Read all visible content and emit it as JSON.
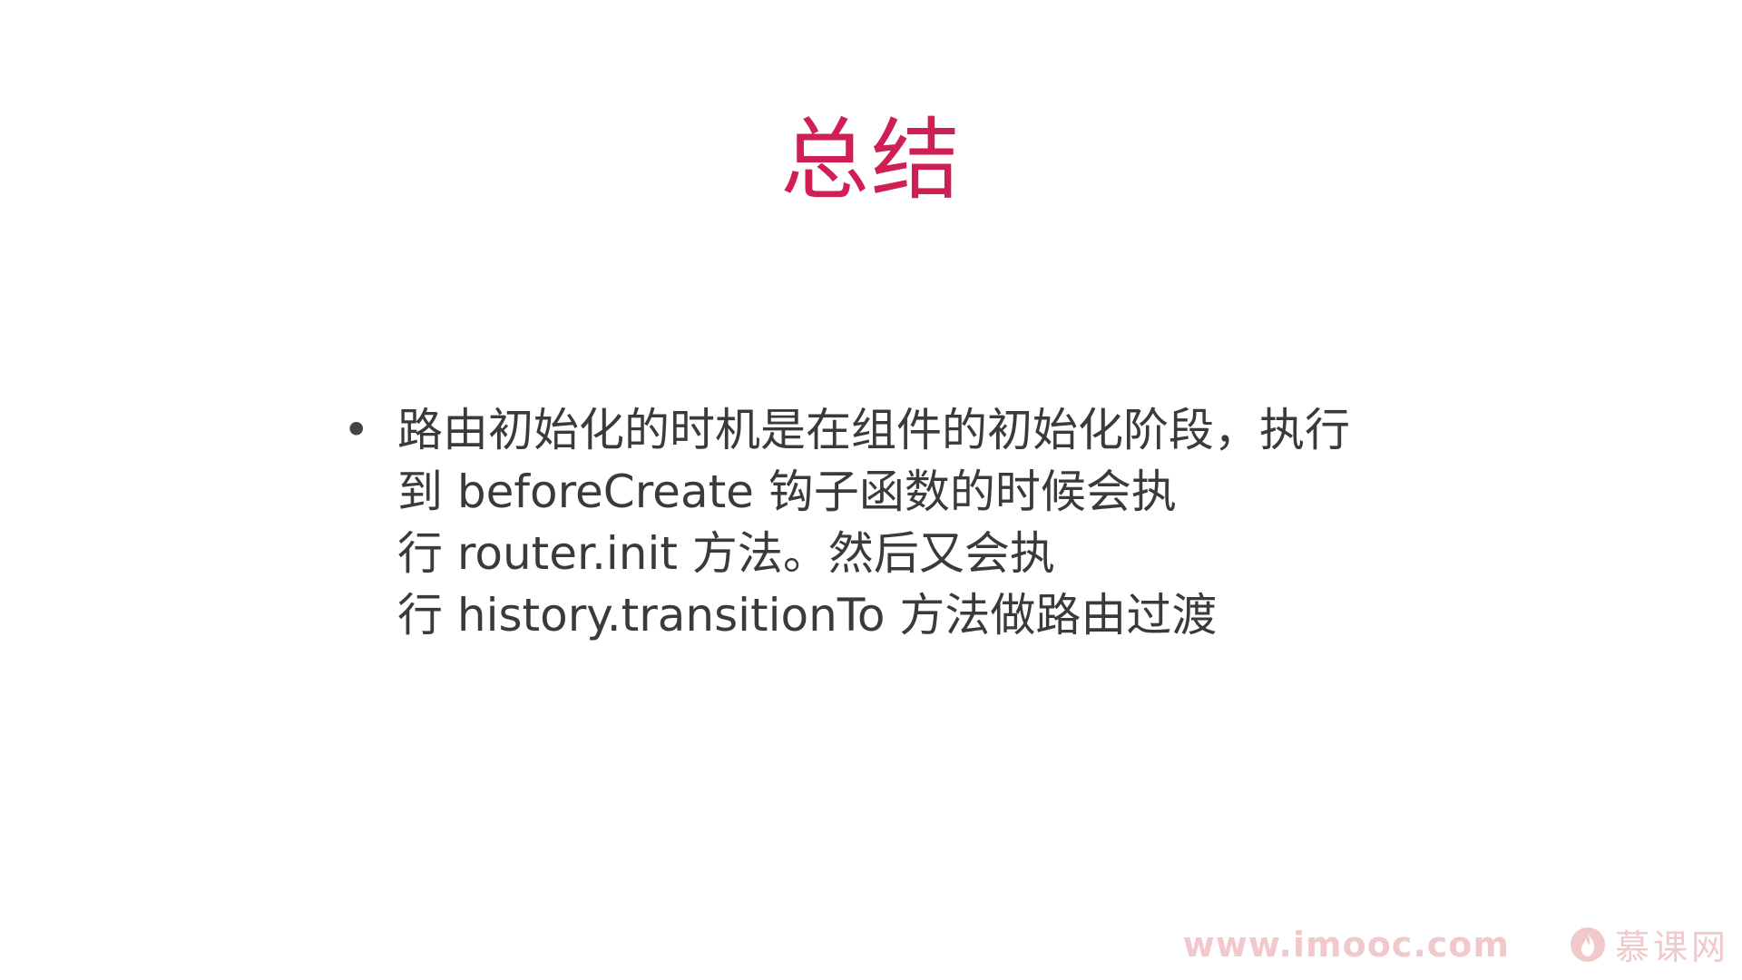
{
  "slide": {
    "title": "总结",
    "bullets": [
      {
        "lines": [
          "路由初始化的时机是在组件的初始化阶段，执行",
          "到 beforeCreate 钩子函数的时候会执",
          "行 router.init 方法。然后又会执",
          "行 history.transitionTo 方法做路由过渡"
        ]
      }
    ],
    "bullet_symbol": "•"
  },
  "watermark": {
    "url": "www.imooc.com",
    "brand": "慕课网",
    "logo_icon": "flame-logo-icon",
    "color": "#f2c9cb"
  },
  "colors": {
    "title": "#cf1f53",
    "body_text": "#3a3a3a",
    "background": "#ffffff"
  }
}
